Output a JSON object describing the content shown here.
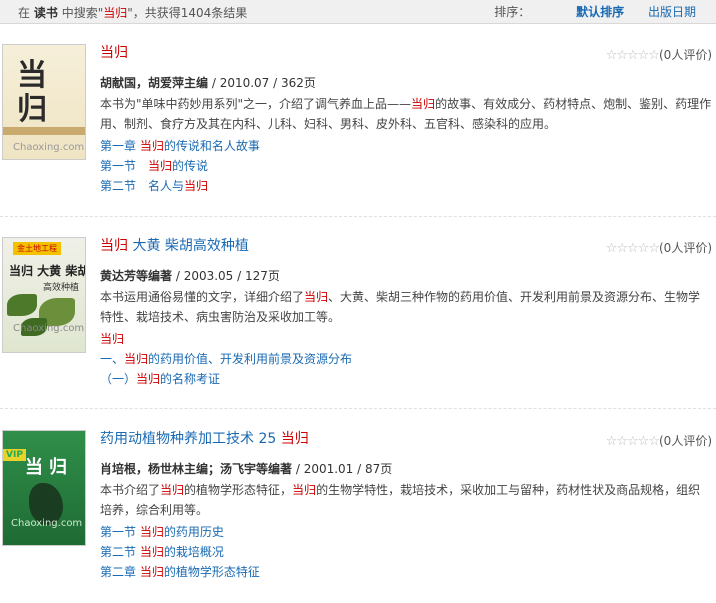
{
  "topbar": {
    "prefix": "在",
    "scope": "读书",
    "middle": "中搜索\"",
    "keyword": "当归",
    "suffix": "\"，共获得1404条结果",
    "sort_label": "排序：",
    "sort_default": "默认排序",
    "sort_date": "出版日期"
  },
  "results": [
    {
      "title_parts": [
        "当归"
      ],
      "rating_stars": "☆☆☆☆☆",
      "rating_text": "(0人评价)",
      "authors": "胡献国，胡爱萍主编",
      "pub": " / 2010.07 / 362页",
      "desc_a": "本书为\"单味中药妙用系列\"之一，介绍了调气养血上品——",
      "desc_hl": "当归",
      "desc_b": "的故事、有效成分、药材特点、炮制、鉴别、药理作用、制剂、食疗方及其在内科、儿科、妇科、男科、皮外科、五官科、感染科的应用。",
      "ch1_a": "第一章 ",
      "ch1_hl": "当归",
      "ch1_b": "的传说和名人故事",
      "ch2_a": "第一节　",
      "ch2_hl": "当归",
      "ch2_b": "的传说",
      "ch3_a": "第二节　名人与",
      "ch3_hl": "当归",
      "ch3_b": "",
      "cover": {
        "big": "当\n归",
        "watermark": "Chaoxing.com"
      }
    },
    {
      "title_hl": "当归",
      "title_rest": " 大黄 柴胡高效种植",
      "rating_stars": "☆☆☆☆☆",
      "rating_text": "(0人评价)",
      "authors": "黄达芳等编著",
      "pub": " / 2003.05 / 127页",
      "desc_a": "本书运用通俗易懂的文字，详细介绍了",
      "desc_hl": "当归",
      "desc_b": "、大黄、柴胡三种作物的药用价值、开发利用前景及资源分布、生物学特性、栽培技术、病虫害防治及采收加工等。",
      "ch1_a": "",
      "ch1_hl": "当归",
      "ch1_b": "",
      "ch2_a": "一、",
      "ch2_hl": "当归",
      "ch2_b": "的药用价值、开发利用前景及资源分布",
      "ch3_a": "（一）",
      "ch3_hl": "当归",
      "ch3_b": "的名称考证",
      "cover": {
        "tag": "金土地工程",
        "title": "当归 大黄 柴胡",
        "sub": "高效种植",
        "watermark": "Chaoxing.com"
      }
    },
    {
      "title_rest": "药用动植物种养加工技术 25 ",
      "title_hl": "当归",
      "rating_stars": "☆☆☆☆☆",
      "rating_text": "(0人评价)",
      "authors": "肖培根，杨世林主编；汤飞宇等编著",
      "pub": " / 2001.01 / 87页",
      "desc_a": "本书介绍了",
      "desc_hl": "当归",
      "desc_m": "的植物学形态特征，",
      "desc_hl2": "当归",
      "desc_b": "的生物学特性，栽培技术，采收加工与留种，药材性状及商品规格，组织培养，综合利用等。",
      "ch1_a": "第一节 ",
      "ch1_hl": "当归",
      "ch1_b": "的药用历史",
      "ch2_a": "第二节 ",
      "ch2_hl": "当归",
      "ch2_b": "的栽培概况",
      "ch3_a": "第二章 ",
      "ch3_hl": "当归",
      "ch3_b": "的植物学形态特征",
      "cover": {
        "vip": "VIP",
        "title": "当归",
        "watermark": "Chaoxing.com"
      }
    }
  ]
}
